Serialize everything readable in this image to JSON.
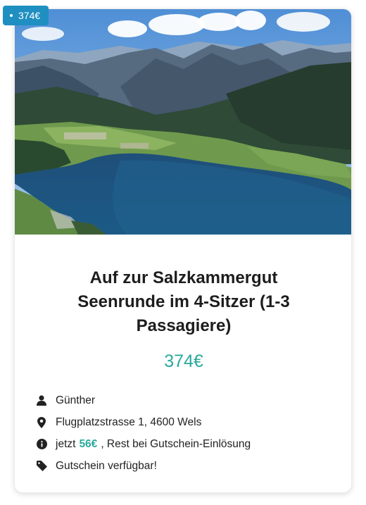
{
  "badge": {
    "price": "374€"
  },
  "offer": {
    "title": "Auf zur Salzkammergut Seenrunde im 4-Sitzer (1-3 Passagiere)",
    "price": "374€"
  },
  "details": {
    "pilot": {
      "icon": "user-icon",
      "text": "Günther"
    },
    "address": {
      "icon": "map-marker-icon",
      "text": "Flugplatzstrasse 1, 4600 Wels"
    },
    "payment": {
      "icon": "info-icon",
      "prefix": "jetzt",
      "deposit": "56€",
      "suffix": ", Rest bei Gutschein-Einlösung"
    },
    "voucher": {
      "icon": "tag-icon",
      "text": "Gutschein verfügbar!"
    }
  },
  "colors": {
    "badge": "#1f8fc2",
    "accent": "#2aa99b",
    "text": "#222222"
  }
}
